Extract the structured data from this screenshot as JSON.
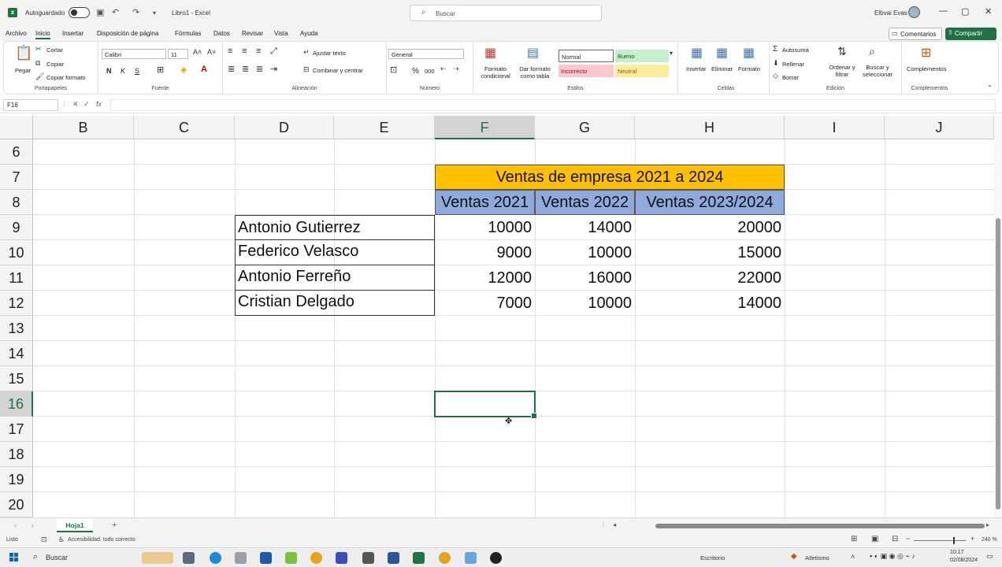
{
  "titlebar": {
    "autosave_label": "Autoguardado",
    "doc_title": "Libro1  -  Excel",
    "search_placeholder": "Buscar",
    "user_name": "Elbvai Evas"
  },
  "menu": {
    "tabs": [
      "Archivo",
      "Inicio",
      "Insertar",
      "Disposición de página",
      "Fórmulas",
      "Datos",
      "Revisar",
      "Vista",
      "Ayuda"
    ],
    "active_tab": "Inicio",
    "comments_label": "Comentarios",
    "share_label": "Compartir"
  },
  "ribbon": {
    "clipboard": {
      "label": "Portapapeles",
      "paste": "Pegar",
      "cut": "Cortar",
      "copy": "Copiar",
      "format_painter": "Copiar formato"
    },
    "font": {
      "label": "Fuente",
      "font_name": "Calibri",
      "font_size": "11",
      "bold": "N",
      "italic": "K",
      "underline": "S"
    },
    "alignment": {
      "label": "Alineación",
      "wrap_text": "Ajustar texto",
      "merge_center": "Combinar y centrar"
    },
    "number": {
      "label": "Número",
      "format": "General",
      "percent": "%",
      "thousands": "000"
    },
    "styles": {
      "label": "Estilos",
      "conditional": "Formato condicional",
      "as_table": "Dar formato como tabla",
      "normal": "Normal",
      "good": "Bueno",
      "bad": "Incorrecto",
      "neutral": "Neutral"
    },
    "cells": {
      "label": "Celdas",
      "insert": "Insertar",
      "delete": "Eliminar",
      "format": "Formato"
    },
    "editing": {
      "label": "Edición",
      "autosum": "Autosuma",
      "fill": "Rellenar",
      "clear": "Borrar",
      "sort_filter": "Ordenar y filtrar",
      "find_select": "Buscar y seleccionar"
    },
    "addins": {
      "label": "Complementos",
      "addins": "Complementos"
    }
  },
  "formula_bar": {
    "name_box": "F16",
    "fx": "fx",
    "content": ""
  },
  "grid": {
    "columns": [
      "B",
      "C",
      "D",
      "E",
      "F",
      "G",
      "H",
      "I",
      "J"
    ],
    "rows": [
      "6",
      "7",
      "8",
      "9",
      "10",
      "11",
      "12",
      "13",
      "14",
      "15",
      "16",
      "17",
      "18",
      "19",
      "20"
    ],
    "selected_column": "F",
    "selected_row": "16"
  },
  "table": {
    "title": "Ventas de empresa 2021 a 2024",
    "headers": [
      "Ventas 2021",
      "Ventas 2022",
      "Ventas 2023/2024"
    ],
    "rows": [
      {
        "name": "Antonio Gutierrez",
        "values": [
          "10000",
          "14000",
          "20000"
        ]
      },
      {
        "name": "Federico Velasco",
        "values": [
          "9000",
          "10000",
          "15000"
        ]
      },
      {
        "name": "Antonio Ferreño",
        "values": [
          "12000",
          "16000",
          "22000"
        ]
      },
      {
        "name": "Cristian Delgado",
        "values": [
          "7000",
          "10000",
          "14000"
        ]
      }
    ]
  },
  "sheets": {
    "active": "Hoja1",
    "add": "+"
  },
  "status": {
    "ready": "Listo",
    "accessibility": "Accesibilidad: todo correcto",
    "zoom": "240 %"
  },
  "taskbar": {
    "search": "Buscar",
    "desktop": "Escritorio",
    "weather": "Atletismo",
    "time": "10:17",
    "date": "02/08/2024"
  },
  "colors": {
    "accent": "#1f7244",
    "title_fill": "#ffc000",
    "header_fill": "#8ea9db"
  }
}
